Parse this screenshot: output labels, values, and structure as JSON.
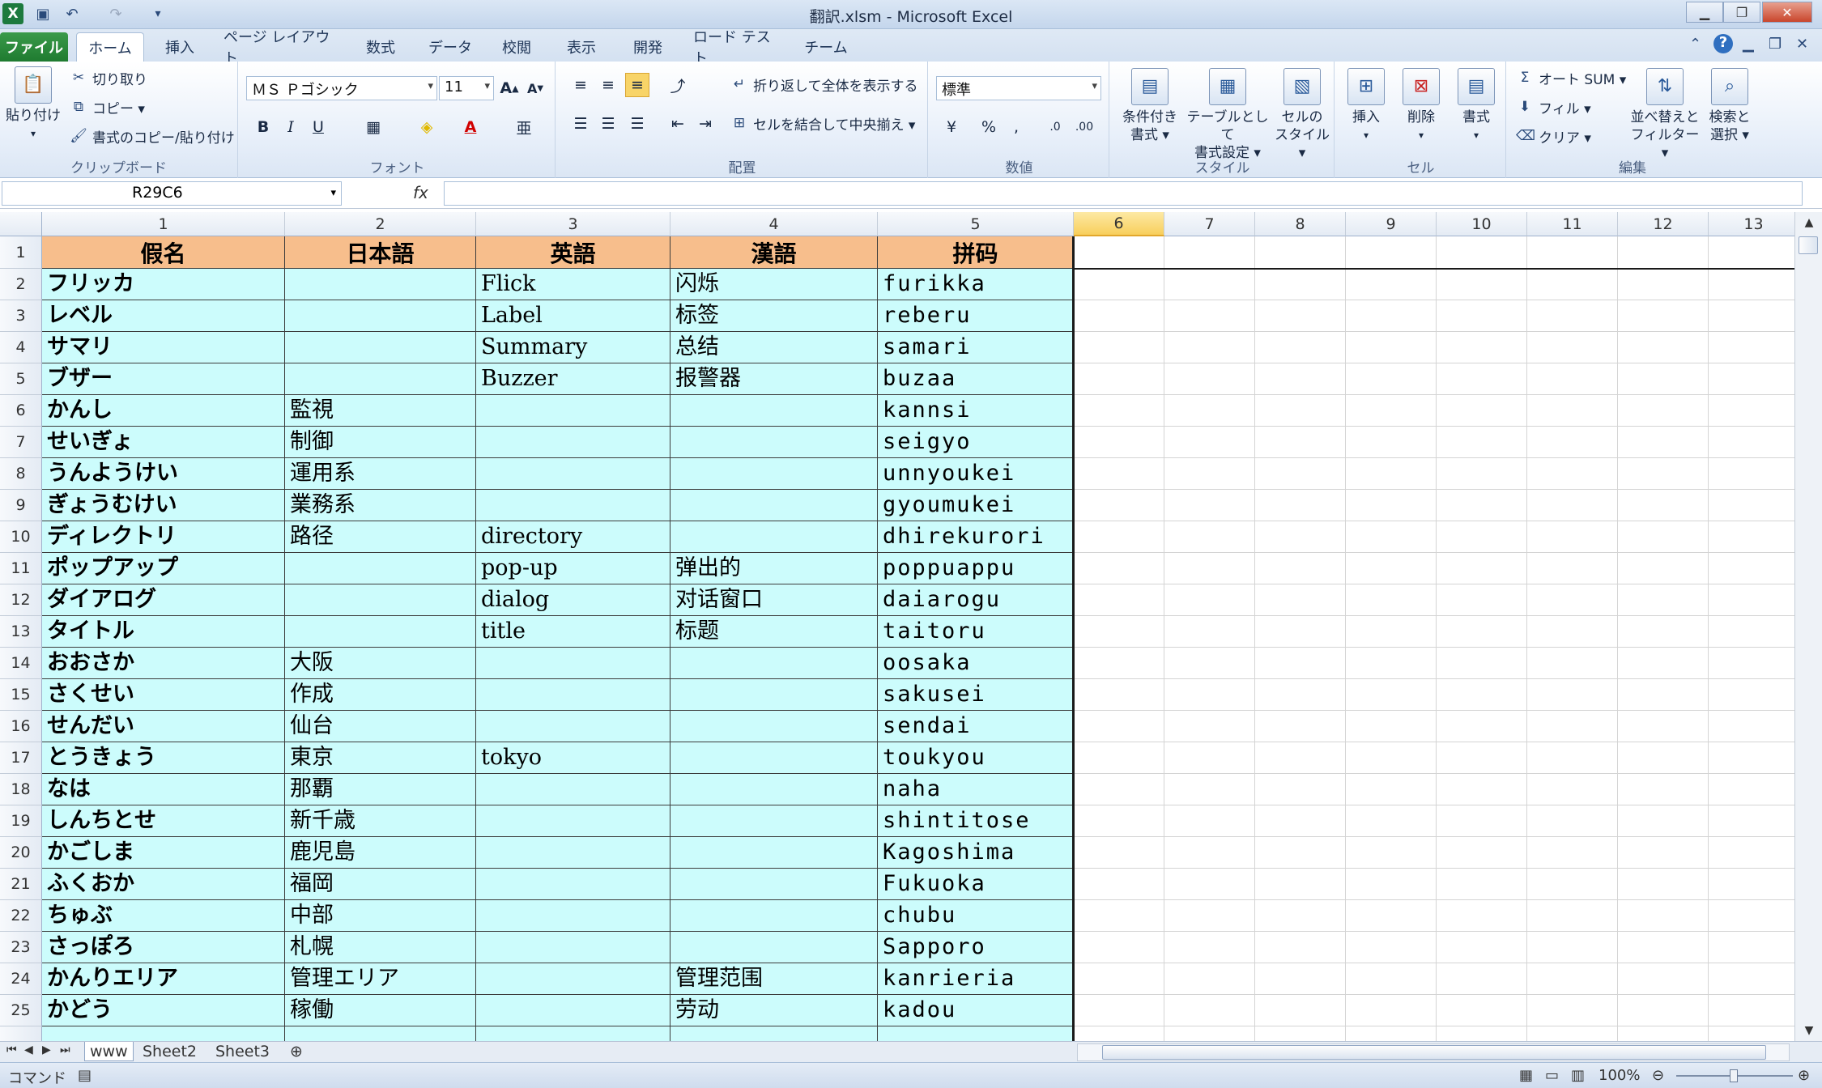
{
  "window": {
    "title": "翻訳.xlsm - Microsoft Excel",
    "logo": "X",
    "controls": [
      "minimize-icon",
      "restore-icon",
      "close-icon"
    ]
  },
  "ribbon_tabs": [
    "ファイル",
    "ホーム",
    "挿入",
    "ページ レイアウト",
    "数式",
    "データ",
    "校閲",
    "表示",
    "開発",
    "ロード テスト",
    "チーム"
  ],
  "clipboard": {
    "paste": "貼り付け",
    "cut": "切り取り",
    "copy": "コピー ▾",
    "format_painter": "書式のコピー/貼り付け",
    "label": "クリップボード"
  },
  "font": {
    "name": "ＭＳ Ｐゴシック",
    "size": "11",
    "label": "フォント"
  },
  "alignment": {
    "wrap": "折り返して全体を表示する",
    "merge": "セルを結合して中央揃え ▾",
    "label": "配置"
  },
  "number": {
    "format": "標準",
    "label": "数値"
  },
  "styles": {
    "conditional": [
      "条件付き",
      "書式 ▾"
    ],
    "table": [
      "テーブルとして",
      "書式設定 ▾"
    ],
    "cell": [
      "セルの",
      "スタイル ▾"
    ],
    "label": "スタイル"
  },
  "cells": {
    "insert": "挿入",
    "delete": "削除",
    "format": "書式",
    "label": "セル"
  },
  "editing": {
    "autosum": "オート SUM ▾",
    "fill": "フィル ▾",
    "clear": "クリア ▾",
    "sort": [
      "並べ替えと",
      "フィルター ▾"
    ],
    "find": [
      "検索と",
      "選択 ▾"
    ],
    "label": "編集"
  },
  "formula_bar": {
    "name_box": "R29C6",
    "fx": "fx",
    "content": ""
  },
  "columns": [
    "1",
    "2",
    "3",
    "4",
    "5",
    "6",
    "7",
    "8",
    "9",
    "10",
    "11",
    "12",
    "13"
  ],
  "selected_column": "6",
  "header_row": [
    "假名",
    "日本語",
    "英語",
    "漢語",
    "拼码"
  ],
  "rows": [
    [
      "2",
      "フリッカ",
      "",
      "Flick",
      "闪烁",
      "furikka"
    ],
    [
      "3",
      "レベル",
      "",
      "Label",
      "标签",
      "reberu"
    ],
    [
      "4",
      "サマリ",
      "",
      "Summary",
      "总结",
      "samari"
    ],
    [
      "5",
      "ブザー",
      "",
      "Buzzer",
      "报警器",
      "buzaa"
    ],
    [
      "6",
      "かんし",
      "監視",
      "",
      "",
      "kannsi"
    ],
    [
      "7",
      "せいぎょ",
      "制御",
      "",
      "",
      "seigyo"
    ],
    [
      "8",
      "うんようけい",
      "運用系",
      "",
      "",
      "unnyoukei"
    ],
    [
      "9",
      "ぎょうむけい",
      "業務系",
      "",
      "",
      "gyoumukei"
    ],
    [
      "10",
      "ディレクトリ",
      "路径",
      "directory",
      "",
      "dhirekurori"
    ],
    [
      "11",
      "ポップアップ",
      "",
      "pop-up",
      "弹出的",
      "poppuappu"
    ],
    [
      "12",
      "ダイアログ",
      "",
      "dialog",
      "对话窗口",
      "daiarogu"
    ],
    [
      "13",
      "タイトル",
      "",
      "title",
      "标题",
      "taitoru"
    ],
    [
      "14",
      "おおさか",
      "大阪",
      "",
      "",
      "oosaka"
    ],
    [
      "15",
      "さくせい",
      "作成",
      "",
      "",
      "sakusei"
    ],
    [
      "16",
      "せんだい",
      "仙台",
      "",
      "",
      "sendai"
    ],
    [
      "17",
      "とうきょう",
      "東京",
      "tokyo",
      "",
      "toukyou"
    ],
    [
      "18",
      "なは",
      "那覇",
      "",
      "",
      "naha"
    ],
    [
      "19",
      "しんちとせ",
      "新千歳",
      "",
      "",
      "shintitose"
    ],
    [
      "20",
      "かごしま",
      "鹿児島",
      "",
      "",
      "Kagoshima"
    ],
    [
      "21",
      "ふくおか",
      "福岡",
      "",
      "",
      "Fukuoka"
    ],
    [
      "22",
      "ちゅぶ",
      "中部",
      "",
      "",
      "chubu"
    ],
    [
      "23",
      "さっぽろ",
      "札幌",
      "",
      "",
      "Sapporo"
    ],
    [
      "24",
      "かんりエリア",
      "管理エリア",
      "",
      "管理范围",
      "kanrieria"
    ],
    [
      "25",
      "かどう",
      "稼働",
      "",
      "劳动",
      "kadou"
    ]
  ],
  "sheets": [
    "www",
    "Sheet2",
    "Sheet3"
  ],
  "active_sheet": "www",
  "status": {
    "mode": "コマンド",
    "zoom": "100%"
  }
}
